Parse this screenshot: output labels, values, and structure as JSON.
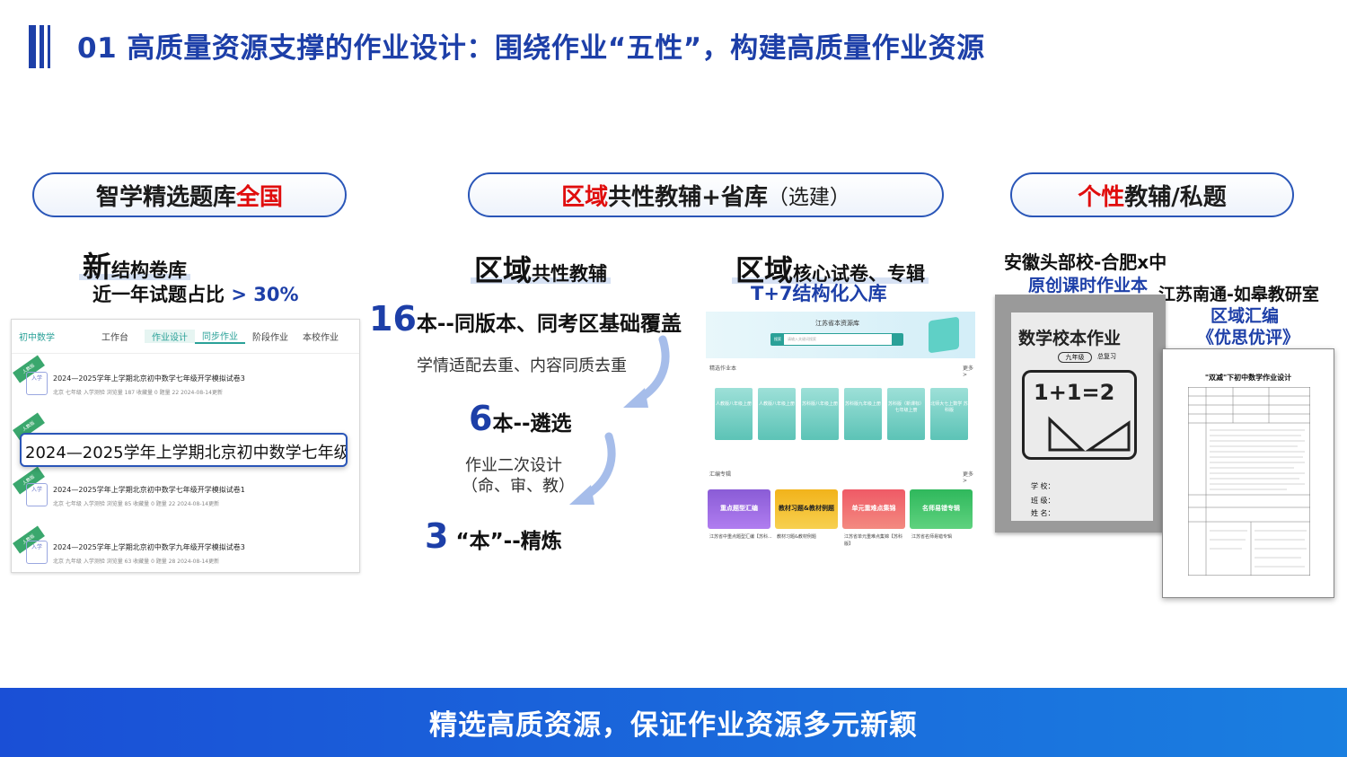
{
  "header": {
    "title": "01 高质量资源支撑的作业设计：围绕作业“五性”，构建高质量作业资源"
  },
  "pill_left": {
    "part1": "智学精选题库",
    "part2": "全国"
  },
  "pill_center": {
    "red": "区域",
    "dark": "共性教辅+省库",
    "small": "（选建）"
  },
  "pill_right": {
    "red": "个性",
    "dark": "教辅/私题"
  },
  "left": {
    "heading_big": "新",
    "heading_rest": "结构卷库",
    "subline_text": "近一年试题占比",
    "subline_value": "> 30%",
    "tabs": [
      "初中数学",
      "工作台",
      "作业设计",
      "同步作业",
      "阶段作业",
      "本校作业"
    ],
    "items": [
      {
        "title": "2024—2025学年上学期北京初中数学七年级开学模拟试卷3",
        "meta": "北京   七年级   入学测验   浏览量 187   收藏量 0   题量 22   2024-08-14更新"
      },
      {
        "title": "2024—2025学年上学期北京初中数学七年级开学模拟试卷1",
        "meta": "北京   七年级   入学测验   浏览量 85   收藏量 0   题量 22   2024-08-14更新"
      },
      {
        "title": "2024—2025学年上学期北京初中数学九年级开学模拟试卷3",
        "meta": "北京   九年级   入学测验   浏览量 63   收藏量 0   题量 28   2024-08-14更新"
      }
    ],
    "zoom_text": "2024—2025学年上学期北京初中数学七年级开学"
  },
  "center": {
    "col1_big": "区域",
    "col1_rest": "共性教辅",
    "line16_num": "16",
    "line16_text": "本--同版本、同考区基础覆盖",
    "line16_sub": "学情适配去重、内容同质去重",
    "line6_num": "6",
    "line6_text": "本--遴选",
    "line6_sub1": "作业二次设计",
    "line6_sub2": "（命、审、教）",
    "line3_num": "3",
    "line3_text": "“本”--精炼",
    "col2_big": "区域",
    "col2_rest": "核心试卷、专辑",
    "col2_sub": "T+7结构化入库",
    "screenshot": {
      "site_title": "江苏省本资源库",
      "search_label": "搜索",
      "search_placeholder": "请输入关键词搜索",
      "section1": "精选作业本",
      "section2": "汇编专辑",
      "more": "更多 >",
      "books": [
        "人教版八年级上册",
        "人教版八年级上册",
        "苏科版八年级上册",
        "苏科版九年级上册",
        "苏科版（新课标）七年级上册",
        "北师大七上数学 苏科版"
      ],
      "cards": [
        "重点题型汇编",
        "教材习题&教材例题",
        "单元重难点集锦",
        "名师易错专辑"
      ],
      "captions": [
        "江苏省中重点题型汇编【苏科...",
        "教材习题&教材例题",
        "江苏省单元重难点集锦【苏科版】",
        "江苏省名师易错专辑"
      ]
    }
  },
  "right": {
    "school1_name": "安徽头部校-合肥x中",
    "school1_sub": "原创课时作业本",
    "school2_name": "江苏南通-如皋教研室",
    "school2_sub1": "区域汇编",
    "school2_sub2": "《优思优评》",
    "doc1": {
      "title": "数学校本作业",
      "grade": "九年级",
      "note": "总复习",
      "equation": "1+1=2",
      "fields": [
        "学 校：",
        "班 级：",
        "姓 名："
      ]
    },
    "doc2": {
      "title": "\"双减\"下初中数学作业设计"
    }
  },
  "footer": {
    "text": "精选高质资源，保证作业资源多元新颖"
  },
  "colors": {
    "brand_blue": "#1d3fa8",
    "accent_red": "#e00d0d",
    "footer_start": "#1a4fd6",
    "footer_end": "#1a7fe0"
  }
}
